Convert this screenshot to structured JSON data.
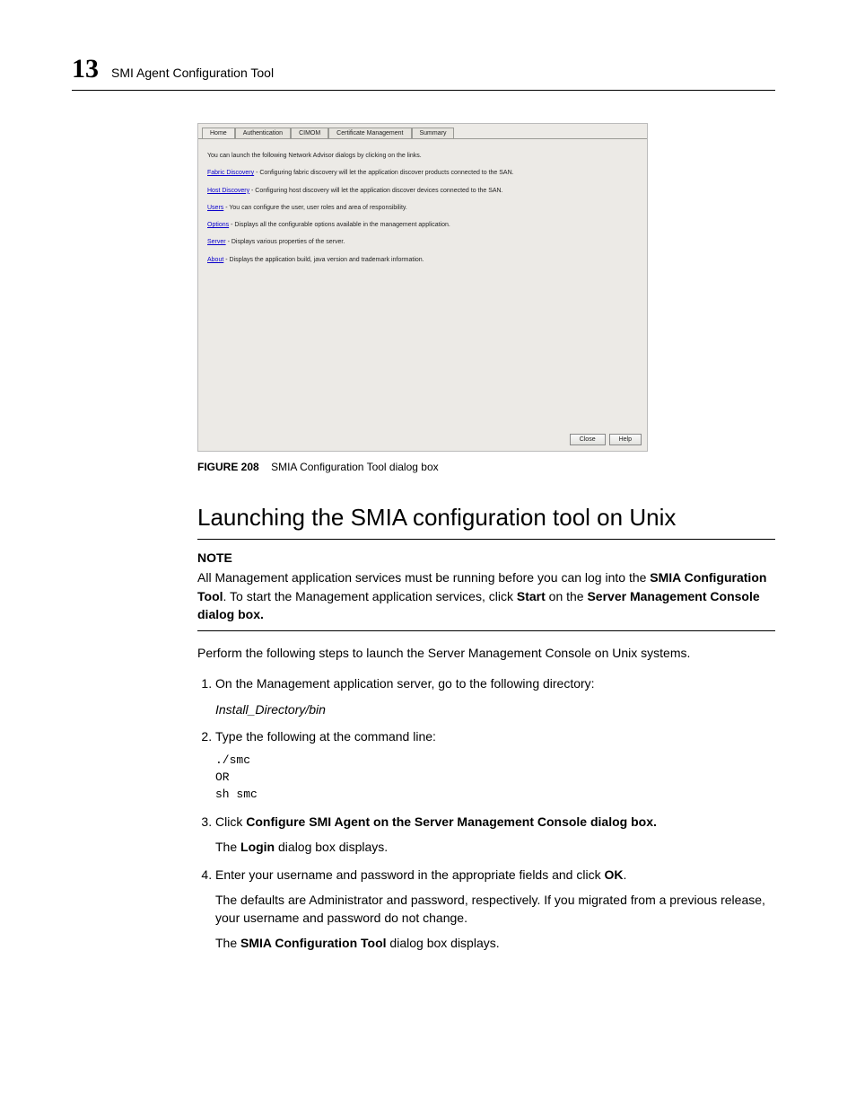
{
  "header": {
    "chapter_number": "13",
    "chapter_title": "SMI Agent Configuration Tool"
  },
  "dialog": {
    "tabs": [
      "Home",
      "Authentication",
      "CIMOM",
      "Certificate Management",
      "Summary"
    ],
    "intro": "You can launch the following Network Advisor dialogs by clicking on the links.",
    "items": [
      {
        "link": "Fabric Discovery",
        "desc": " - Configuring fabric discovery will let the application discover products connected to the SAN."
      },
      {
        "link": "Host Discovery",
        "desc": " - Configuring host discovery will let the application discover devices connected to the SAN."
      },
      {
        "link": "Users",
        "desc": " - You can configure the user, user roles and area of responsibility."
      },
      {
        "link": "Options",
        "desc": " - Displays all the configurable options available in the management application."
      },
      {
        "link": "Server",
        "desc": " - Displays various properties of the server."
      },
      {
        "link": "About",
        "desc": " - Displays the application build, java version and trademark information."
      }
    ],
    "buttons": {
      "close": "Close",
      "help": "Help"
    }
  },
  "figure": {
    "label": "FIGURE 208",
    "caption": "SMIA Configuration Tool dialog box"
  },
  "section_heading": "Launching the SMIA configuration tool on Unix",
  "note": {
    "label": "NOTE",
    "prefix": "All Management application services must be running before you can log into the ",
    "bold1": "SMIA Configuration Tool",
    "mid1": ". To start the Management application services, click ",
    "bold2": "Start",
    "mid2": " on the ",
    "bold3": "Server Management Console dialog box.",
    "suffix": ""
  },
  "intro_para": "Perform the following steps to launch the Server Management Console on Unix systems.",
  "steps": {
    "s1": {
      "text": "On the Management application server, go to the following directory:",
      "path": "Install_Directory/bin"
    },
    "s2": {
      "text": "Type the following at the command line:",
      "cmd": "./smc\nOR\nsh smc"
    },
    "s3": {
      "prefix": "Click ",
      "bold": "Configure SMI Agent on the Server Management Console dialog box.",
      "sub_prefix": "The ",
      "sub_bold": "Login",
      "sub_suffix": " dialog box displays."
    },
    "s4": {
      "prefix": "Enter your username and password in the appropriate fields and click ",
      "bold": "OK",
      "suffix": ".",
      "sub1": "The defaults are Administrator and password, respectively. If you migrated from a previous release, your username and password do not change.",
      "sub2_prefix": "The ",
      "sub2_bold": "SMIA Configuration Tool",
      "sub2_suffix": " dialog box displays."
    }
  }
}
